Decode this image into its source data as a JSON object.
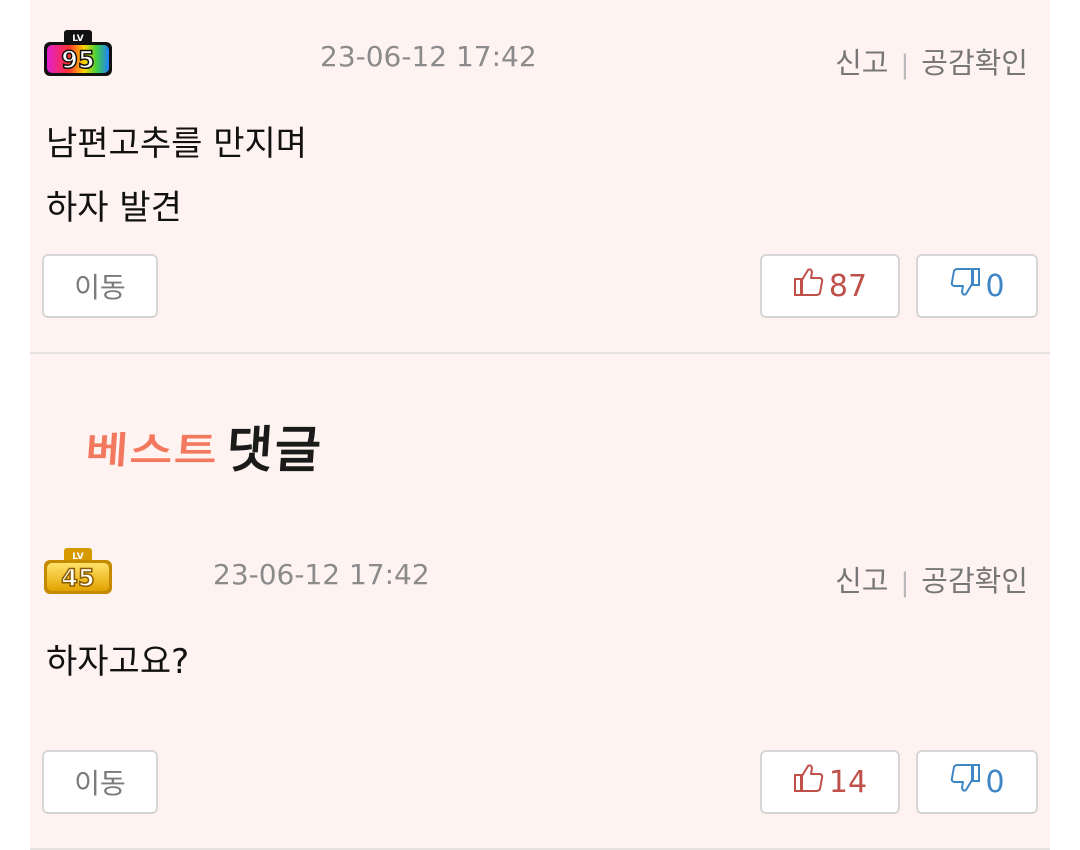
{
  "comments": [
    {
      "level": "95",
      "timestamp": "23-06-12 17:42",
      "report_label": "신고",
      "empathy_check_label": "공감확인",
      "lines": [
        "남편고추를 만지며",
        "하자 발견"
      ],
      "move_label": "이동",
      "likes": "87",
      "dislikes": "0"
    },
    {
      "level": "45",
      "timestamp": "23-06-12 17:42",
      "report_label": "신고",
      "empathy_check_label": "공감확인",
      "lines": [
        "하자고요?"
      ],
      "move_label": "이동",
      "likes": "14",
      "dislikes": "0"
    }
  ],
  "best_banner": {
    "part1": "베스트",
    "part2": "댓글"
  },
  "badge_label": "LV",
  "colors": {
    "background": "#fff3f1",
    "like": "#c0504a",
    "dislike": "#3f86c4",
    "best_accent": "#f2795e"
  },
  "icons": {
    "like": "thumbs-up-icon",
    "dislike": "thumbs-down-icon"
  }
}
